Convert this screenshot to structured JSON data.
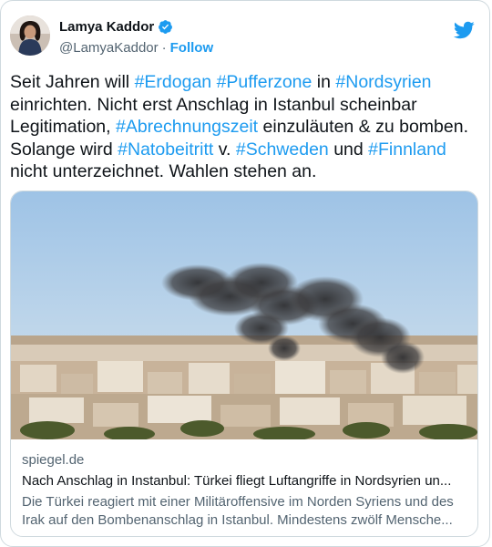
{
  "author": {
    "name": "Lamya Kaddor",
    "handle": "@LamyaKaddor",
    "separator": "·",
    "follow_label": "Follow"
  },
  "tweet": {
    "parts": [
      {
        "t": "Seit Jahren will ",
        "tag": false
      },
      {
        "t": "#Erdogan",
        "tag": true
      },
      {
        "t": " ",
        "tag": false
      },
      {
        "t": "#Pufferzone",
        "tag": true
      },
      {
        "t": " in ",
        "tag": false
      },
      {
        "t": "#Nordsyrien",
        "tag": true
      },
      {
        "t": " einrichten. Nicht erst Anschlag in Istanbul scheinbar Legitimation, ",
        "tag": false
      },
      {
        "t": "#Abrechnungszeit",
        "tag": true
      },
      {
        "t": " einzuläuten & zu bomben. Solange wird ",
        "tag": false
      },
      {
        "t": "#Natobeitritt",
        "tag": true
      },
      {
        "t": " v. ",
        "tag": false
      },
      {
        "t": "#Schweden",
        "tag": true
      },
      {
        "t": " und ",
        "tag": false
      },
      {
        "t": "#Finnland",
        "tag": true
      },
      {
        "t": " nicht unterzeichnet. Wahlen stehen an.",
        "tag": false
      }
    ]
  },
  "link_card": {
    "domain": "spiegel.de",
    "headline": "Nach Anschlag in Instanbul: Türkei fliegt Luftangriffe in Nordsyrien un...",
    "description": "Die Türkei reagiert mit einer Militäroffensive im Norden Syriens und des Irak auf den Bombenanschlag in Istanbul. Mindestens zwölf Mensche..."
  },
  "colors": {
    "accent": "#1d9bf0",
    "text": "#0f1419",
    "secondary": "#536471"
  },
  "icons": {
    "verified": "verified-badge-icon",
    "brand": "twitter-bird-icon"
  }
}
